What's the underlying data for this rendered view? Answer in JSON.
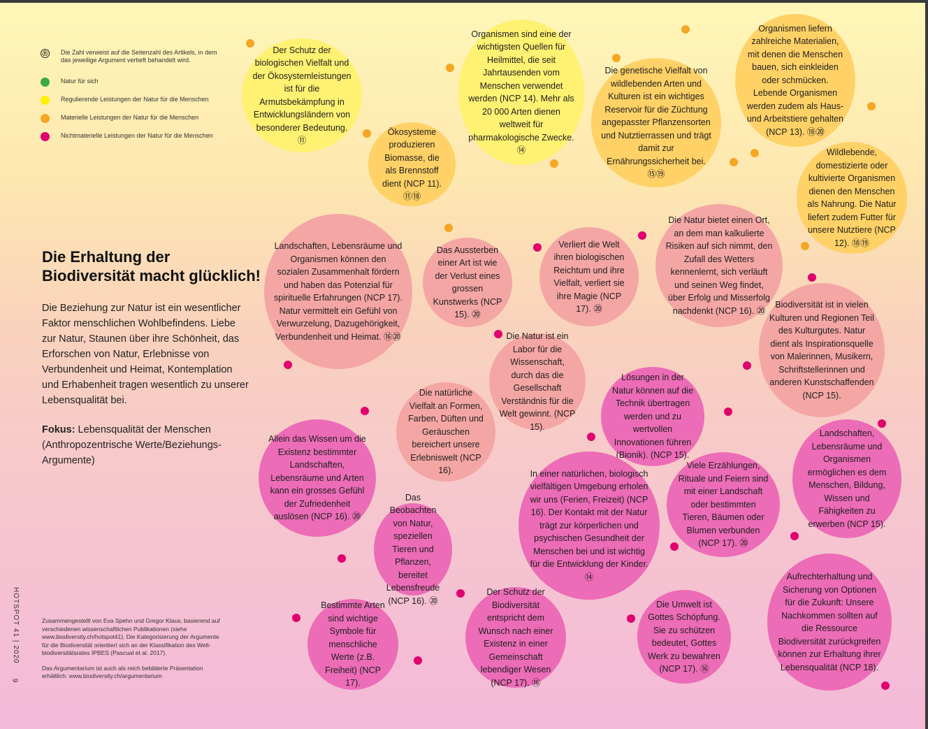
{
  "legend": [
    {
      "kind": "number",
      "symbol": "⑪",
      "text": "Die Zahl verweist auf die Seitenzahl des Artikels, in dem das jeweilige Argument vertieft behandelt wird."
    },
    {
      "kind": "color",
      "color": "#3aaa48",
      "text": "Natur für sich"
    },
    {
      "kind": "color",
      "color": "#fff200",
      "text": "Regulierende Leistungen der Natur für die Menschen"
    },
    {
      "kind": "color",
      "color": "#f5a623",
      "text": "Materielle Leistungen der Natur für die Menschen"
    },
    {
      "kind": "color",
      "color": "#e0006e",
      "text": "Nichtmaterielle Leistungen der Natur für die Menschen"
    }
  ],
  "headline": "Die Erhaltung der Biodiversität macht glücklich!",
  "intro": "Die Beziehung zur Natur ist ein wesentlicher Faktor menschlichen Wohlbefindens. Liebe zur Natur, Staunen über ihre Schönheit, das Erforschen von Natur, Erlebnisse von Verbundenheit und Heimat, Kontemplation und Erhabenheit tragen wesentlich zu unserer Lebensqualität bei.",
  "focus": {
    "label": "Fokus:",
    "text": " Lebensqualität der Menschen (Anthropozentrische Werte/Beziehungs-Argumente)"
  },
  "running_head": "HOTSPOT 41 | 2020",
  "page_number": "9",
  "credits": "Zusammengestellt von Eva Spehn und Gregor Klaus, basierend auf verschiedenen wissenschaftlichen Publikationen (siehe www.biodiversity.ch/hotspot41). Die Kategorisierung der Argumente für die Biodiversität orientiert sich an der Klassifikation des Welt-biodiversitätsrates IPBES (Pascual et al. 2017).",
  "presentation_note": "Das Argumentarium ist auch als reich bebilderte Präsentation erhältlich: www.biodiversity.ch/argumentarium",
  "colors": {
    "regulating": "#fff172",
    "material": "#ffd166",
    "nonmaterial_light": "#f4a6a5",
    "nonmaterial": "#ec6cb7",
    "dot_orange": "#f5a623",
    "dot_magenta": "#e0006e"
  },
  "bubbles": [
    {
      "id": "armut",
      "text": "Der Schutz der biologischen Vielfalt und der Ökosystemleistungen ist für die Armutsbekämpfung in Entwicklungsländern von besonderer Bedeutung. ⑪"
    },
    {
      "id": "heilmittel",
      "text": "Organismen sind eine der wichtigsten Quellen für Heilmittel, die seit Jahrtausenden vom Menschen verwendet werden (NCP 14). Mehr als 20 000 Arten dienen weltweit für pharmakologische Zwecke. ⑭"
    },
    {
      "id": "genetisch",
      "text": "Die genetische Vielfalt von wildlebenden Arten und Kulturen ist ein wichtiges Reservoir für die Züchtung angepasster Pflanzensorten und Nutztierrassen und trägt damit zur Ernährungssicherheit bei. ⑮⑲"
    },
    {
      "id": "materialien",
      "text": "Organismen liefern zahlreiche Materialien, mit denen die Menschen bauen, sich einkleiden oder schmücken. Lebende Organismen werden zudem als Haus- und Arbeitstiere gehalten (NCP 13). ⑱⑳"
    },
    {
      "id": "biomasse",
      "text": "Ökosysteme produzieren Biomasse, die als Brennstoff dient (NCP 11). ⑪⑱"
    },
    {
      "id": "nahrung",
      "text": "Wildlebende, domestizierte oder kultivierte Organismen dienen den Menschen als Nahrung. Die Natur liefert zudem Futter für unsere Nutztiere (NCP 12). ⑱⑲"
    },
    {
      "id": "landschaften1",
      "text": "Landschaften, Lebensräume und Organismen können den sozialen Zusammenhalt fördern und haben das Potenzial für spirituelle Erfahrungen (NCP 17). Natur vermittelt ein Gefühl von Verwurzelung, Dazugehörigkeit, Verbundenheit und Heimat. ⑯⑳"
    },
    {
      "id": "aussterben",
      "text": "Das Aussterben einer Art ist wie der Verlust eines grossen Kunstwerks (NCP 15). ⑳"
    },
    {
      "id": "magie",
      "text": "Verliert die Welt ihren biologischen Reichtum und ihre Vielfalt, verliert sie ihre Magie (NCP 17). ⑳"
    },
    {
      "id": "risiken",
      "text": "Die Natur bietet einen Ort, an dem man kalkulierte Risiken auf sich nimmt, den Zufall des Wetters kennenlernt, sich verläuft und seinen Weg findet, über Erfolg und Misserfolg nachdenkt (NCP 16). ⑳"
    },
    {
      "id": "kulturgut",
      "text": "Biodiversität ist in vielen Kulturen und Regionen Teil des Kulturgutes. Natur dient als Inspirationsquelle von Malerinnen, Musikern, Schriftstellerinnen und anderen Kunstschaffenden (NCP 15)."
    },
    {
      "id": "labor",
      "text": "Die Natur ist ein Labor für die Wissenschaft, durch das die Gesellschaft Verständnis für die Welt gewinnt. (NCP 15)."
    },
    {
      "id": "bionik",
      "text": "Lösungen in der Natur können auf die Technik übertragen werden und zu wertvollen Innovationen führen (Bionik). (NCP 15)."
    },
    {
      "id": "vielfalt",
      "text": "Die natürliche Vielfalt an Formen, Farben, Düften und Geräuschen bereichert unsere Erlebniswelt (NCP 16)."
    },
    {
      "id": "wissen",
      "text": "Allein das Wissen um die Existenz bestimmter Landschaften, Lebensräume und Arten kann ein grosses Gefühl der Zufriedenheit auslösen (NCP 16). ⑳"
    },
    {
      "id": "bildung",
      "text": "Landschaften, Lebensräume und Organismen ermöglichen es dem Menschen, Bildung, Wissen und Fähigkeiten zu erwerben (NCP 15)."
    },
    {
      "id": "erzaehlungen",
      "text": "Viele Erzählungen, Rituale und Feiern sind mit einer Landschaft oder bestimmten Tieren, Bäumen oder Blumen verbunden (NCP 17). ⑳"
    },
    {
      "id": "erholen",
      "text": "In einer natürlichen, biologisch vielfältigen Umgebung erholen wir uns (Ferien, Freizeit) (NCP 16). Der Kontakt mit der Natur trägt zur körperlichen und psychischen Gesundheit der Menschen bei und ist wichtig für die Entwicklung der Kinder. ⑭"
    },
    {
      "id": "beobachten",
      "text": "Das Beobachten von Natur, speziellen Tieren und Pflanzen, bereitet Lebensfreude (NCP 16). ⑳"
    },
    {
      "id": "existenz",
      "text": "Der Schutz der Biodiversität entspricht dem Wunsch nach einer Existenz in einer Gemeinschaft lebendiger Wesen (NCP 17). ⑯"
    },
    {
      "id": "symbole",
      "text": "Bestimmte Arten sind wichtige Symbole für menschliche Werte (z.B. Freiheit) (NCP 17)."
    },
    {
      "id": "schoepfung",
      "text": "Die Umwelt ist Gottes Schöpfung. Sie zu schützen bedeutet, Gottes Werk zu bewahren (NCP 17). ⑯"
    },
    {
      "id": "optionen",
      "text": "Aufrechterhaltung und Sicherung von Optionen für die Zukunft: Unsere Nachkommen sollten auf die Ressource Biodiversität zurückgreifen können zur Erhaltung ihrer Lebensqualität (NCP 18)."
    }
  ]
}
